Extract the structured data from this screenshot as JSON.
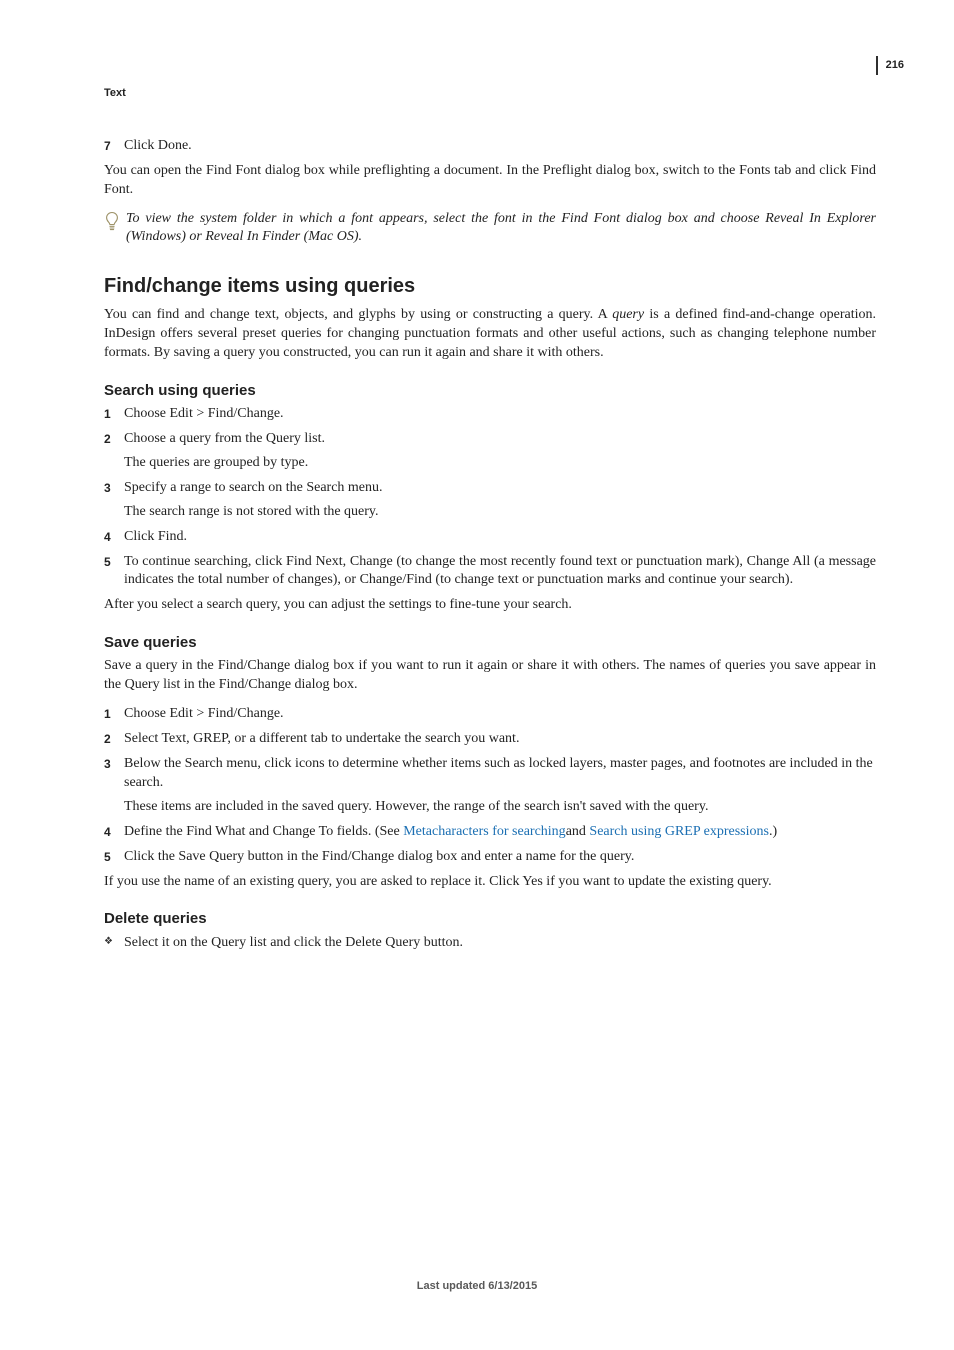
{
  "breadcrumb": "Text",
  "page_number": "216",
  "top_list": {
    "item7_num": "7",
    "item7": "Click Done."
  },
  "top_para": "You can open the Find Font dialog box while preflighting a document. In the Preflight dialog box, switch to the Fonts tab and click Find Font.",
  "tip": "To view the system folder in which a font appears, select the font in the Find Font dialog box and choose Reveal In Explorer (Windows) or Reveal In Finder (Mac OS).",
  "h2": "Find/change items using queries",
  "intro_a": "You can find and change text, objects, and glyphs by using or constructing a query. A ",
  "intro_term": "query",
  "intro_b": " is a defined find-and-change operation. InDesign offers several preset queries for changing punctuation formats and other useful actions, such as changing telephone number formats. By saving a query you constructed, you can run it again and share it with others.",
  "search_h3": "Search using queries",
  "search_list": {
    "n1": "1",
    "t1": "Choose Edit > Find/Change.",
    "n2": "2",
    "t2": "Choose a query from the Query list.",
    "t2b": "The queries are grouped by type.",
    "n3": "3",
    "t3": "Specify a range to search on the Search menu.",
    "t3b": "The search range is not stored with the query.",
    "n4": "4",
    "t4": "Click Find.",
    "n5": "5",
    "t5": "To continue searching, click Find Next, Change (to change the most recently found text or punctuation mark), Change All (a message indicates the total number of changes), or Change/Find (to change text or punctuation marks and continue your search)."
  },
  "search_after": "After you select a search query, you can adjust the settings to fine-tune your search.",
  "save_h3": "Save queries",
  "save_intro": "Save a query in the Find/Change dialog box if you want to run it again or share it with others. The names of queries you save appear in the Query list in the Find/Change dialog box.",
  "save_list": {
    "n1": "1",
    "t1": "Choose Edit > Find/Change.",
    "n2": "2",
    "t2": "Select Text, GREP, or a different tab to undertake the search you want.",
    "n3": "3",
    "t3": "Below the Search menu, click icons to determine whether items such as locked layers, master pages, and footnotes are included in the search.",
    "t3b": "These items are included in the saved query. However, the range of the search isn't saved with the query.",
    "n4": "4",
    "t4a": "Define the Find What and Change To fields. (See ",
    "t4link1": "Metacharacters for searching",
    "t4mid": "and ",
    "t4link2": "Search using GREP expressions",
    "t4b": ".)",
    "n5": "5",
    "t5": "Click the Save Query button in the Find/Change dialog box and enter a name for the query."
  },
  "save_after": "If you use the name of an existing query, you are asked to replace it. Click Yes if you want to update the existing query.",
  "delete_h3": "Delete queries",
  "delete_item": "Select it on the Query list and click the Delete Query button.",
  "footer": "Last updated 6/13/2015"
}
